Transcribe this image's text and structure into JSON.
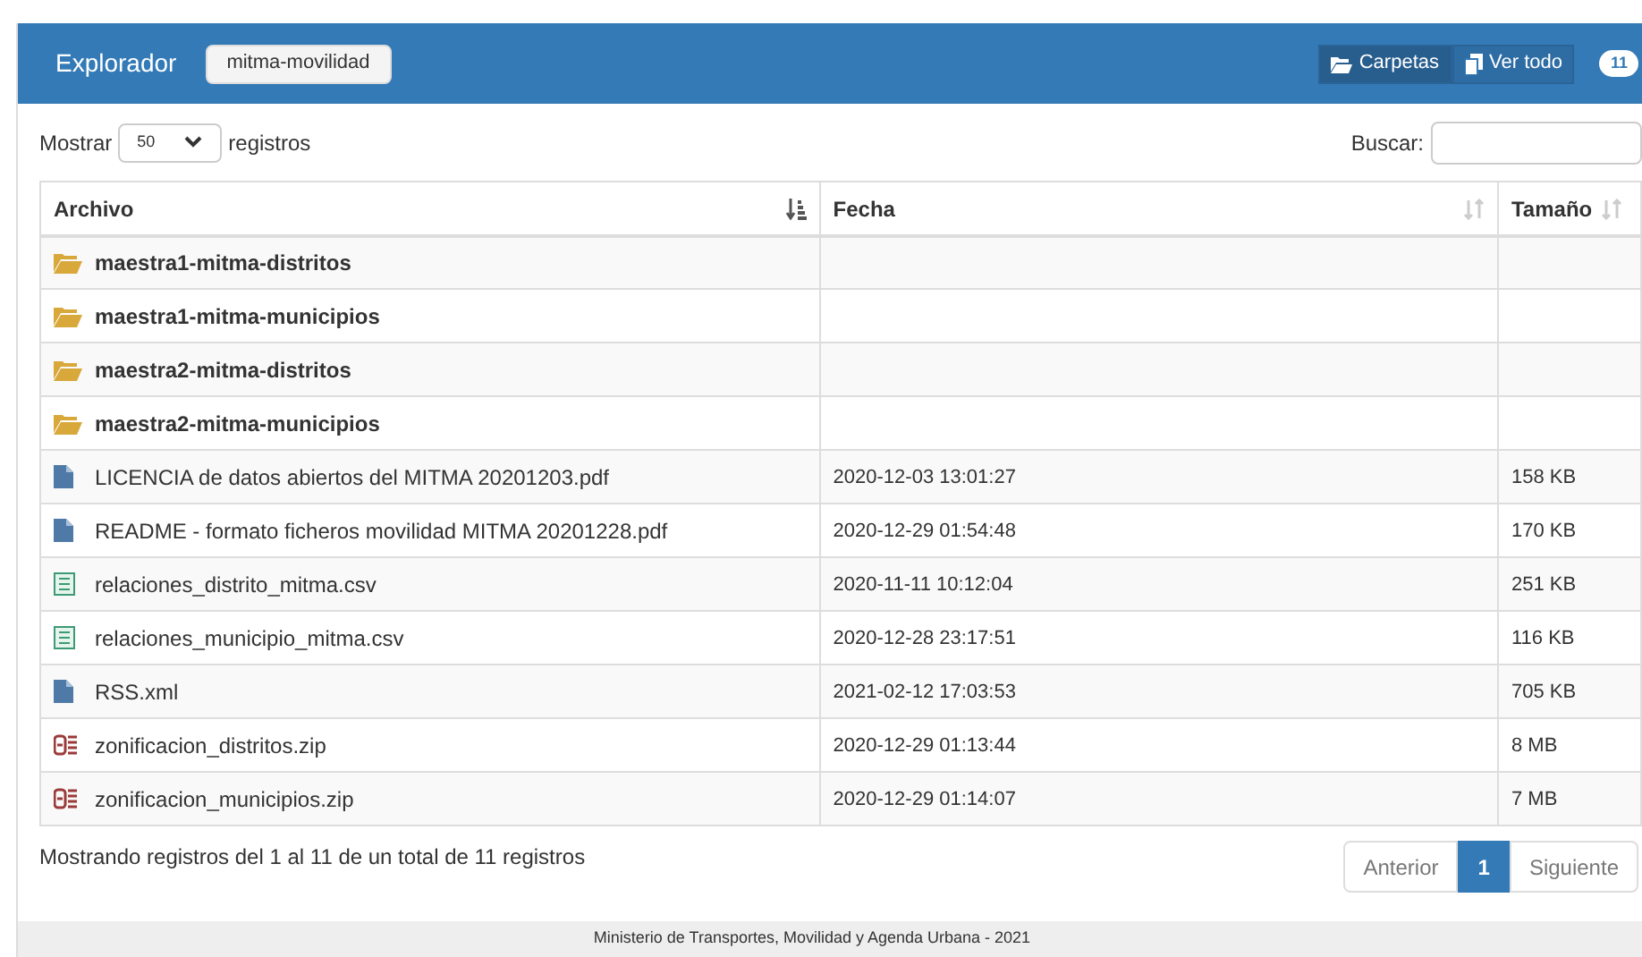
{
  "header": {
    "title": "Explorador",
    "bucket": "mitma-movilidad",
    "views": [
      {
        "label": "Carpetas",
        "kind": "folder",
        "selected": true
      },
      {
        "label": "Ver todo",
        "kind": "files",
        "selected": false
      }
    ],
    "count": "11"
  },
  "controls": {
    "show_label": "Mostrar",
    "page_size": "50",
    "records_label": "registros",
    "search_label": "Buscar:"
  },
  "table": {
    "columns": [
      {
        "label": "Archivo",
        "sorted": true
      },
      {
        "label": "Fecha",
        "sorted": false
      },
      {
        "label": "Tamaño",
        "sorted": false
      }
    ],
    "rows": [
      {
        "kind": "folder",
        "name": "maestra1-mitma-distritos"
      },
      {
        "kind": "folder",
        "name": "maestra1-mitma-municipios"
      },
      {
        "kind": "folder",
        "name": "maestra2-mitma-distritos"
      },
      {
        "kind": "folder",
        "name": "maestra2-mitma-municipios"
      },
      {
        "kind": "file",
        "name": "LICENCIA de datos abiertos del MITMA 20201203.pdf",
        "date": "2020-12-03 13:01:27",
        "size": "158 KB"
      },
      {
        "kind": "file",
        "name": "README - formato ficheros movilidad MITMA 20201228.pdf",
        "date": "2020-12-29 01:54:48",
        "size": "170 KB"
      },
      {
        "kind": "csv",
        "name": "relaciones_distrito_mitma.csv",
        "date": "2020-11-11 10:12:04",
        "size": "251 KB"
      },
      {
        "kind": "csv",
        "name": "relaciones_municipio_mitma.csv",
        "date": "2020-12-28 23:17:51",
        "size": "116 KB"
      },
      {
        "kind": "file",
        "name": "RSS.xml",
        "date": "2021-02-12 17:03:53",
        "size": "705 KB"
      },
      {
        "kind": "zip",
        "name": "zonificacion_distritos.zip",
        "date": "2020-12-29 01:13:44",
        "size": "8 MB"
      },
      {
        "kind": "zip",
        "name": "zonificacion_municipios.zip",
        "date": "2020-12-29 01:14:07",
        "size": "7 MB"
      }
    ]
  },
  "info": "Mostrando registros del 1 al 11 de un total de 11 registros",
  "pagination": [
    {
      "label": "Anterior",
      "kind": "prev",
      "selected": false
    },
    {
      "label": "1",
      "kind": "page",
      "selected": true
    },
    {
      "label": "Siguiente",
      "kind": "next",
      "selected": false
    }
  ],
  "footer": "Ministerio de Transportes, Movilidad y Agenda Urbana - 2021"
}
